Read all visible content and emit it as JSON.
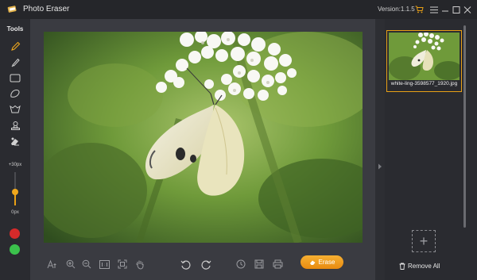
{
  "titlebar": {
    "title": "Photo Eraser",
    "version": "Version:1.1.5"
  },
  "toolbar": {
    "tools_label": "Tools",
    "tools": [
      "pencil-icon",
      "brush-icon",
      "rectangle-icon",
      "lasso-icon",
      "magic-wand-icon",
      "stamp-icon",
      "eraser-icon"
    ],
    "brush_max": "+30px",
    "brush_min": "0px",
    "brush_level": 0.4,
    "colors": [
      "#d52a2a",
      "#3bc24c"
    ]
  },
  "bottombar": {
    "erase_label": "Erase"
  },
  "rightpanel": {
    "thumbnail_name": "white-ling-3598577_1920.jpg",
    "remove_all_label": "Remove All",
    "add_symbol": "+"
  },
  "colors": {
    "accent": "#e9a016",
    "background": "#2a2b30",
    "canvas": "#3a3b41"
  }
}
